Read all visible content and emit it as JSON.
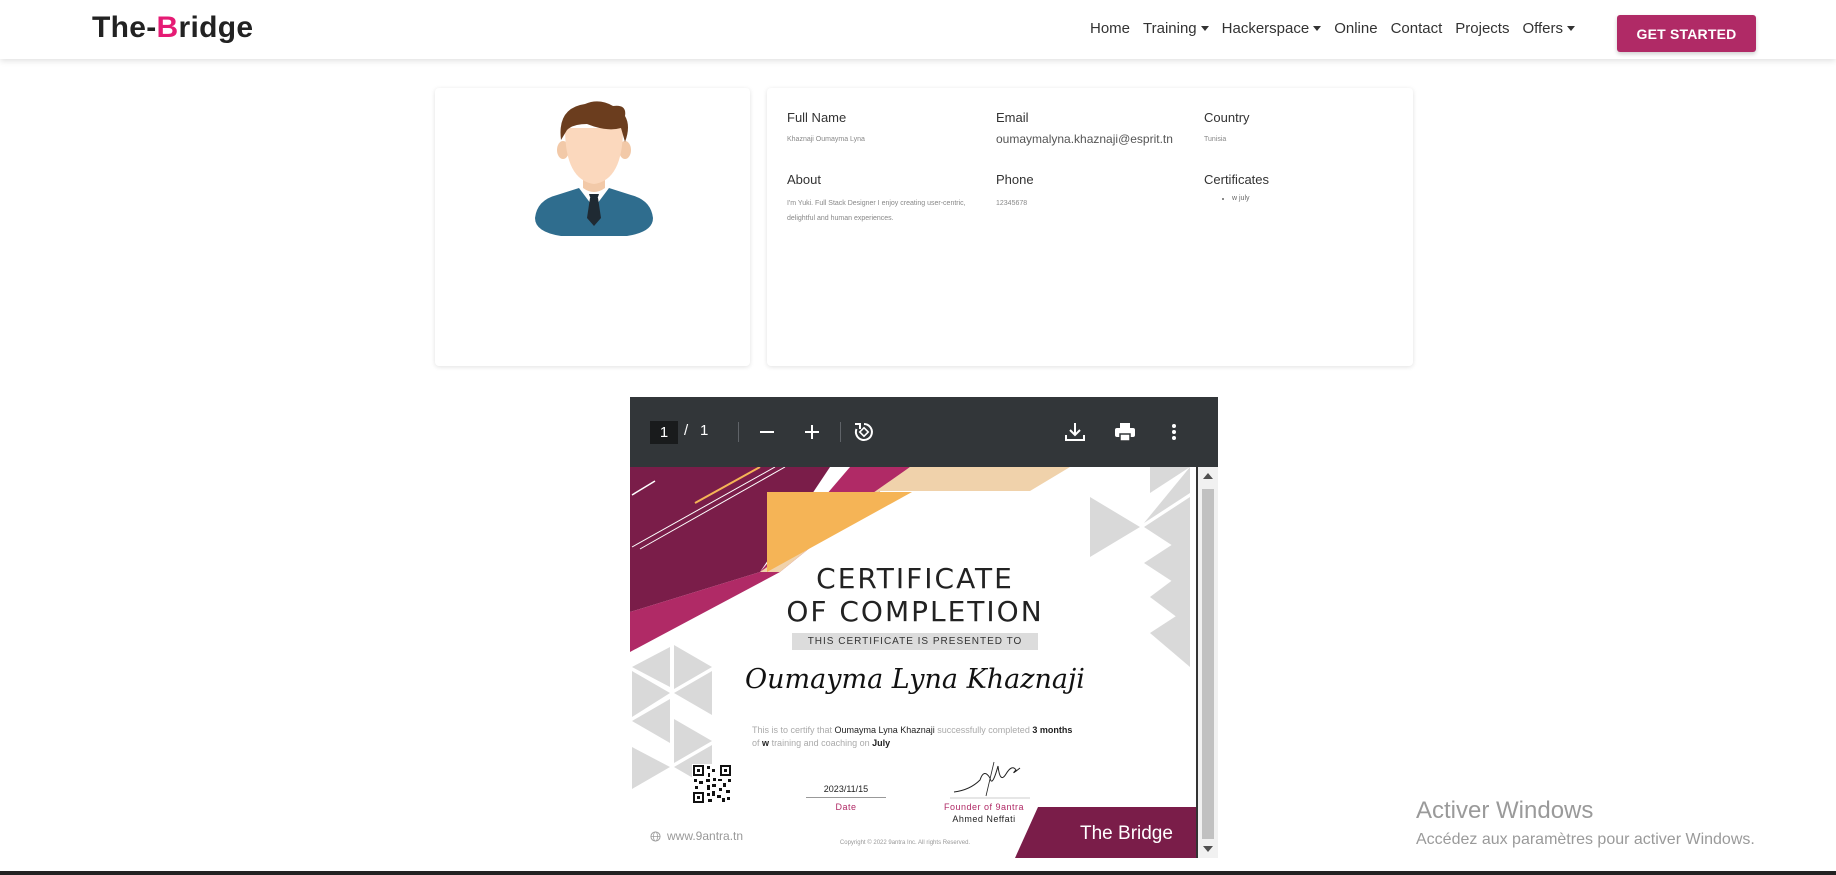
{
  "brand": {
    "prefix": "The-",
    "accent": "B",
    "suffix": "ridge"
  },
  "nav": {
    "items": [
      {
        "label": "Home",
        "dropdown": false
      },
      {
        "label": "Training",
        "dropdown": true
      },
      {
        "label": "Hackerspace",
        "dropdown": true
      },
      {
        "label": "Online",
        "dropdown": false
      },
      {
        "label": "Contact",
        "dropdown": false
      },
      {
        "label": "Projects",
        "dropdown": false
      },
      {
        "label": "Offers",
        "dropdown": true
      }
    ],
    "cta_label": "GET STARTED"
  },
  "profile": {
    "full_name_label": "Full Name",
    "full_name": "Khaznaji Oumayma Lyna",
    "email_label": "Email",
    "email": "oumaymalyna.khaznaji@esprit.tn",
    "country_label": "Country",
    "country": "Tunisia",
    "about_label": "About",
    "about": "I'm Yuki. Full Stack Designer I enjoy creating user-centric, delightful and human experiences.",
    "phone_label": "Phone",
    "phone": "12345678",
    "certificates_label": "Certificates",
    "certificates": [
      "w july"
    ]
  },
  "pdf": {
    "current_page": "1",
    "separator": "/",
    "total_pages": "1",
    "certificate": {
      "title_line1": "CERTIFICATE",
      "title_line2": "OF COMPLETION",
      "presented_to": "THIS CERTIFICATE IS PRESENTED TO",
      "recipient": "Oumayma Lyna  Khaznaji",
      "body_prefix": "This is to certify that",
      "body_name": "Oumayma Lyna  Khaznaji",
      "body_mid": "successfully completed",
      "duration": "3 months",
      "body_of": "of",
      "course": "w",
      "body_training": "training and coaching on",
      "month": "July",
      "date": "2023/11/15",
      "date_label": "Date",
      "founder_label": "Founder of 9antra",
      "founder_name": "Ahmed Neffati",
      "website": "www.9antra.tn",
      "copyright": "Copyright © 2022 9antra Inc. All rights Reserved.",
      "brand": "The Bridge"
    }
  },
  "watermark": {
    "title": "Activer Windows",
    "subtitle": "Accédez aux paramètres pour activer Windows."
  },
  "icons": {
    "zoom_out": "minus-icon",
    "zoom_in": "plus-icon",
    "rotate": "rotate-icon",
    "download": "download-icon",
    "print": "print-icon",
    "more": "more-vertical-icon"
  },
  "colors": {
    "accent": "#b02a66",
    "brand_pink": "#e51b74",
    "toolbar": "#323639"
  }
}
